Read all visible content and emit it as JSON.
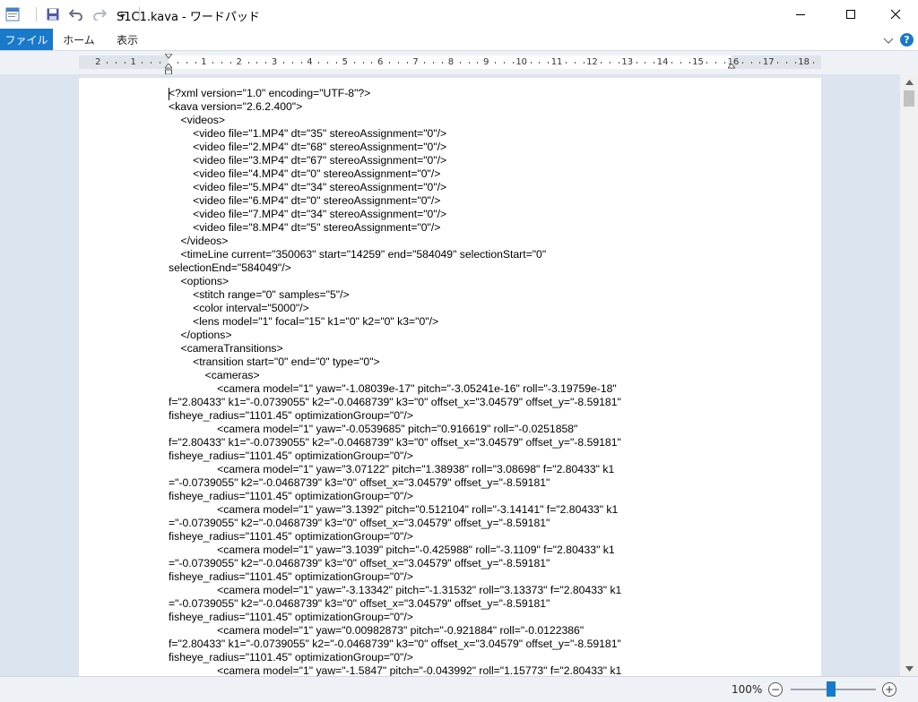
{
  "window": {
    "title": "S1C1.kava - ワードパッド",
    "minimize_icon": "minimize-icon",
    "maximize_icon": "maximize-icon",
    "close_icon": "close-icon"
  },
  "quick_access": [
    "save-icon",
    "undo-icon",
    "redo-icon",
    "customize-dropdown-icon"
  ],
  "ribbon": {
    "tabs": [
      {
        "label": "ファイル",
        "active": true
      },
      {
        "label": "ホーム",
        "active": false
      },
      {
        "label": "表示",
        "active": false
      }
    ],
    "help_label": "?"
  },
  "ruler": {
    "labels": [
      "2",
      "1",
      "",
      "1",
      "2",
      "3",
      "4",
      "5",
      "6",
      "7",
      "8",
      "9",
      "10",
      "11",
      "12",
      "13",
      "14",
      "15",
      "16",
      "17",
      "18"
    ]
  },
  "document": {
    "lines": [
      "<?xml version=\"1.0\" encoding=\"UTF-8\"?>",
      "<kava version=\"2.6.2.400\">",
      "    <videos>",
      "        <video file=\"1.MP4\" dt=\"35\" stereoAssignment=\"0\"/>",
      "        <video file=\"2.MP4\" dt=\"68\" stereoAssignment=\"0\"/>",
      "        <video file=\"3.MP4\" dt=\"67\" stereoAssignment=\"0\"/>",
      "        <video file=\"4.MP4\" dt=\"0\" stereoAssignment=\"0\"/>",
      "        <video file=\"5.MP4\" dt=\"34\" stereoAssignment=\"0\"/>",
      "        <video file=\"6.MP4\" dt=\"0\" stereoAssignment=\"0\"/>",
      "        <video file=\"7.MP4\" dt=\"34\" stereoAssignment=\"0\"/>",
      "        <video file=\"8.MP4\" dt=\"5\" stereoAssignment=\"0\"/>",
      "    </videos>",
      "    <timeLine current=\"350063\" start=\"14259\" end=\"584049\" selectionStart=\"0\"",
      "selectionEnd=\"584049\"/>",
      "    <options>",
      "        <stitch range=\"0\" samples=\"5\"/>",
      "        <color interval=\"5000\"/>",
      "        <lens model=\"1\" focal=\"15\" k1=\"0\" k2=\"0\" k3=\"0\"/>",
      "    </options>",
      "    <cameraTransitions>",
      "        <transition start=\"0\" end=\"0\" type=\"0\">",
      "            <cameras>",
      "                <camera model=\"1\" yaw=\"-1.08039e-17\" pitch=\"-3.05241e-16\" roll=\"-3.19759e-18\"",
      "f=\"2.80433\" k1=\"-0.0739055\" k2=\"-0.0468739\" k3=\"0\" offset_x=\"3.04579\" offset_y=\"-8.59181\"",
      "fisheye_radius=\"1101.45\" optimizationGroup=\"0\"/>",
      "                <camera model=\"1\" yaw=\"-0.0539685\" pitch=\"0.916619\" roll=\"-0.0251858\"",
      "f=\"2.80433\" k1=\"-0.0739055\" k2=\"-0.0468739\" k3=\"0\" offset_x=\"3.04579\" offset_y=\"-8.59181\"",
      "fisheye_radius=\"1101.45\" optimizationGroup=\"0\"/>",
      "                <camera model=\"1\" yaw=\"3.07122\" pitch=\"1.38938\" roll=\"3.08698\" f=\"2.80433\" k1",
      "=\"-0.0739055\" k2=\"-0.0468739\" k3=\"0\" offset_x=\"3.04579\" offset_y=\"-8.59181\"",
      "fisheye_radius=\"1101.45\" optimizationGroup=\"0\"/>",
      "                <camera model=\"1\" yaw=\"3.1392\" pitch=\"0.512104\" roll=\"-3.14141\" f=\"2.80433\" k1",
      "=\"-0.0739055\" k2=\"-0.0468739\" k3=\"0\" offset_x=\"3.04579\" offset_y=\"-8.59181\"",
      "fisheye_radius=\"1101.45\" optimizationGroup=\"0\"/>",
      "                <camera model=\"1\" yaw=\"3.1039\" pitch=\"-0.425988\" roll=\"-3.1109\" f=\"2.80433\" k1",
      "=\"-0.0739055\" k2=\"-0.0468739\" k3=\"0\" offset_x=\"3.04579\" offset_y=\"-8.59181\"",
      "fisheye_radius=\"1101.45\" optimizationGroup=\"0\"/>",
      "                <camera model=\"1\" yaw=\"-3.13342\" pitch=\"-1.31532\" roll=\"3.13373\" f=\"2.80433\" k1",
      "=\"-0.0739055\" k2=\"-0.0468739\" k3=\"0\" offset_x=\"3.04579\" offset_y=\"-8.59181\"",
      "fisheye_radius=\"1101.45\" optimizationGroup=\"0\"/>",
      "                <camera model=\"1\" yaw=\"0.00982873\" pitch=\"-0.921884\" roll=\"-0.0122386\"",
      "f=\"2.80433\" k1=\"-0.0739055\" k2=\"-0.0468739\" k3=\"0\" offset_x=\"3.04579\" offset_y=\"-8.59181\"",
      "fisheye_radius=\"1101.45\" optimizationGroup=\"0\"/>",
      "                <camera model=\"1\" yaw=\"-1.5847\" pitch=\"-0.043992\" roll=\"1.15773\" f=\"2.80433\" k1"
    ]
  },
  "statusbar": {
    "zoom_label": "100%",
    "zoom_level_percent": 100,
    "zoom_minus": "−",
    "zoom_plus": "+"
  },
  "colors": {
    "accent": "#1979ca",
    "canvas_bg": "#dce4ef",
    "statusbar_bg": "#eef1f6"
  }
}
